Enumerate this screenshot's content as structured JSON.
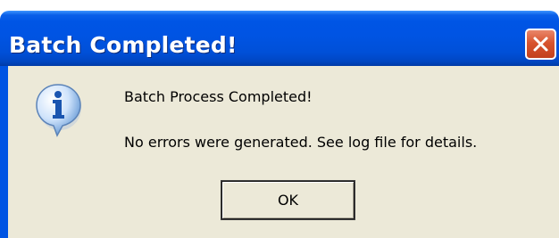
{
  "window": {
    "title": "Batch Completed!"
  },
  "icons": {
    "close": "close-icon",
    "message": "information-icon"
  },
  "message": {
    "line1": "Batch Process Completed!",
    "line2": "No errors were generated. See log file for details."
  },
  "buttons": {
    "ok_label": "OK"
  },
  "colors": {
    "titlebar": "#0054e3",
    "client_background": "#ece9d8",
    "close_button": "#d8542f",
    "title_text": "#ffffff"
  }
}
